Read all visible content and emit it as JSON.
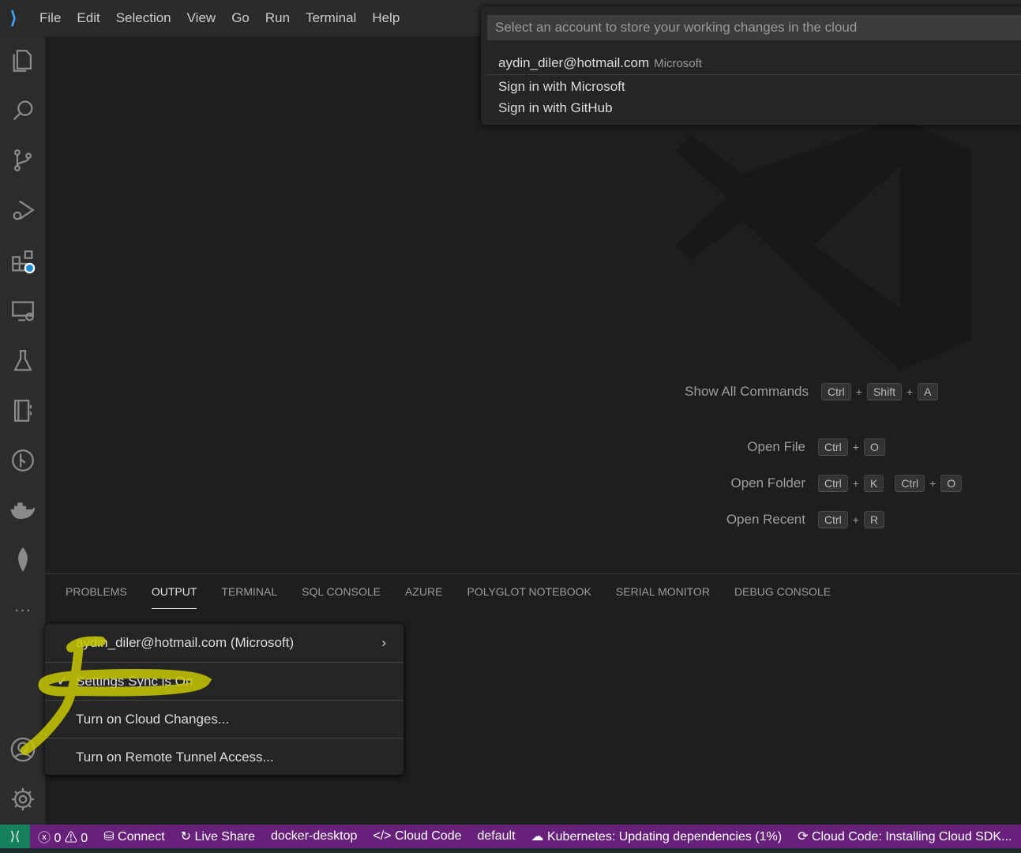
{
  "menu": [
    "File",
    "Edit",
    "Selection",
    "View",
    "Go",
    "Run",
    "Terminal",
    "Help"
  ],
  "activity_icons": [
    "explorer-icon",
    "search-icon",
    "source-control-icon",
    "run-debug-icon",
    "extensions-icon",
    "remote-explorer-icon",
    "testing-icon",
    "notebook-icon",
    "git-graph-icon",
    "docker-icon",
    "mongodb-icon",
    "more-icon",
    "accounts-icon",
    "manage-gear-icon"
  ],
  "quickpick": {
    "placeholder": "Select an account to store your working changes in the cloud",
    "items": [
      {
        "label": "aydin_diler@hotmail.com",
        "desc": "Microsoft"
      },
      {
        "label": "Sign in with Microsoft"
      },
      {
        "label": "Sign in with GitHub"
      }
    ]
  },
  "shortcuts": [
    {
      "label": "Show All Commands",
      "keys": [
        [
          "Ctrl",
          "Shift",
          "A"
        ]
      ]
    },
    {
      "label": "Open File",
      "keys": [
        [
          "Ctrl",
          "O"
        ]
      ]
    },
    {
      "label": "Open Folder",
      "keys": [
        [
          "Ctrl",
          "K"
        ],
        [
          "Ctrl",
          "O"
        ]
      ]
    },
    {
      "label": "Open Recent",
      "keys": [
        [
          "Ctrl",
          "R"
        ]
      ]
    }
  ],
  "panel_tabs": [
    "PROBLEMS",
    "OUTPUT",
    "TERMINAL",
    "SQL CONSOLE",
    "AZURE",
    "POLYGLOT NOTEBOOK",
    "SERIAL MONITOR",
    "DEBUG CONSOLE"
  ],
  "panel_active": "OUTPUT",
  "account_menu": [
    "aydin_diler@hotmail.com (Microsoft)",
    "Settings Sync is On",
    "Turn on Cloud Changes...",
    "Turn on Remote Tunnel Access..."
  ],
  "status": {
    "errors": "0",
    "warnings": "0",
    "connect": "Connect",
    "liveshare": "Live Share",
    "docker": "docker-desktop",
    "cloudcode": "Cloud Code",
    "default": "default",
    "kubernetes": "Kubernetes: Updating dependencies (1%)",
    "cloudsdk": "Cloud Code: Installing Cloud SDK..."
  },
  "colors": {
    "statusbar": "#68217a",
    "remote": "#16825d",
    "highlight": "#c8c800"
  }
}
